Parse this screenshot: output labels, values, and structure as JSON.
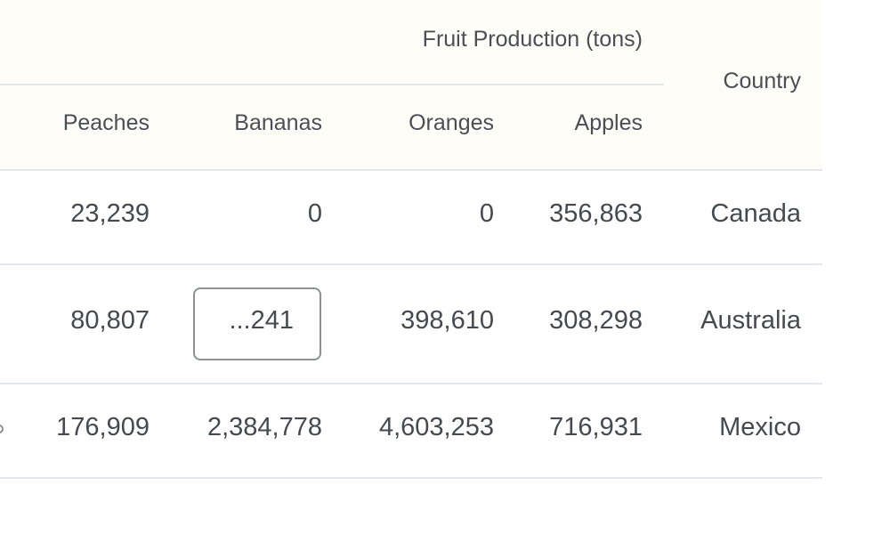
{
  "table": {
    "group_header": "Fruit Production (tons)",
    "country_header": "Country",
    "columns": [
      "Peaches",
      "Bananas",
      "Oranges",
      "Apples"
    ],
    "rows": [
      {
        "peaches": "23,239",
        "bananas": "0",
        "oranges": "0",
        "apples": "356,863",
        "country": "Canada"
      },
      {
        "peaches": "80,807",
        "bananas": "...241",
        "oranges": "398,610",
        "apples": "308,298",
        "country": "Australia"
      },
      {
        "peaches": "176,909",
        "bananas": "2,384,778",
        "oranges": "4,603,253",
        "apples": "716,931",
        "country": "Mexico"
      }
    ],
    "focused_cell": {
      "row": 1,
      "column": "Bananas"
    }
  },
  "colors": {
    "header_background": "#fffdf8",
    "rule": "#e3e8ef",
    "text": "#454a50",
    "focus_border": "#8d9196"
  }
}
